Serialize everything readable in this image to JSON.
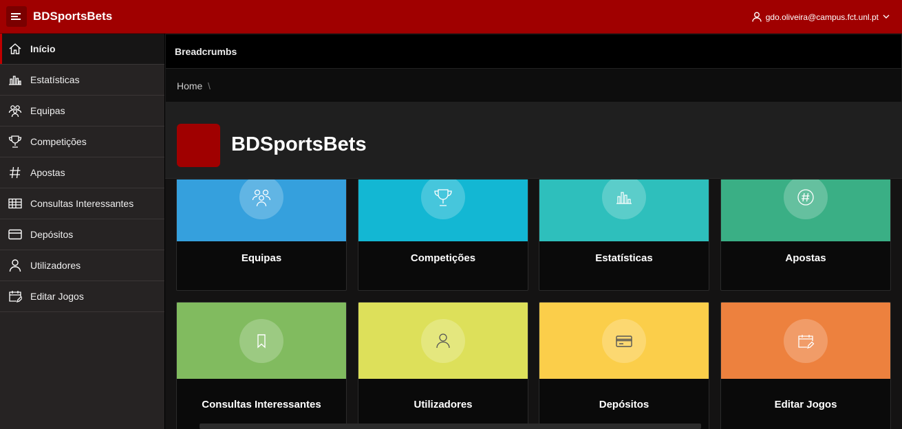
{
  "app": {
    "title": "BDSportsBets",
    "brand_color": "#a00000"
  },
  "header": {
    "menu_icon": "hamburger-icon",
    "user_icon": "user-icon",
    "user_email": "gdo.oliveira@campus.fct.unl.pt"
  },
  "sidebar": {
    "items": [
      {
        "label": "Início",
        "icon": "home-icon",
        "active": true
      },
      {
        "label": "Estatísticas",
        "icon": "bar-chart-icon"
      },
      {
        "label": "Equipas",
        "icon": "users-icon"
      },
      {
        "label": "Competições",
        "icon": "trophy-icon"
      },
      {
        "label": "Apostas",
        "icon": "hash-icon"
      },
      {
        "label": "Consultas Interessantes",
        "icon": "table-icon"
      },
      {
        "label": "Depósitos",
        "icon": "credit-card-icon"
      },
      {
        "label": "Utilizadores",
        "icon": "user-icon"
      },
      {
        "label": "Editar Jogos",
        "icon": "calendar-edit-icon"
      }
    ]
  },
  "breadcrumbs": {
    "title": "Breadcrumbs",
    "home": "Home",
    "separator": "\\"
  },
  "hero": {
    "title": "BDSportsBets"
  },
  "cards": [
    {
      "label": "Equipas",
      "color": "#35a0dd",
      "icon": "users-icon"
    },
    {
      "label": "Competições",
      "color": "#13b7d3",
      "icon": "trophy-icon"
    },
    {
      "label": "Estatísticas",
      "color": "#2ebfbc",
      "icon": "bar-chart-icon"
    },
    {
      "label": "Apostas",
      "color": "#3aaf85",
      "icon": "hash-circle-icon"
    },
    {
      "label": "Consultas Interessantes",
      "color": "#81bb5f",
      "icon": "bookmark-icon"
    },
    {
      "label": "Utilizadores",
      "color": "#dde05a",
      "icon": "user-icon"
    },
    {
      "label": "Depósitos",
      "color": "#fbce4a",
      "icon": "credit-card-icon"
    },
    {
      "label": "Editar Jogos",
      "color": "#ed813e",
      "icon": "calendar-edit-icon"
    }
  ]
}
